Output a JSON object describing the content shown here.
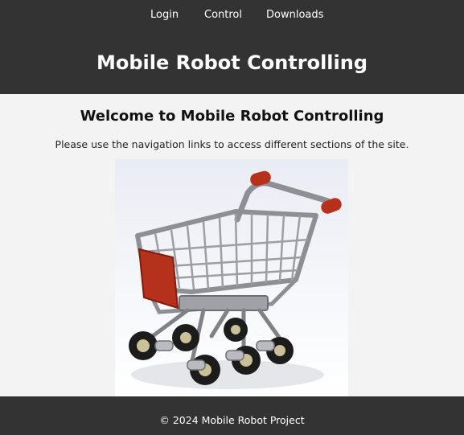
{
  "nav": {
    "items": [
      {
        "label": "Login"
      },
      {
        "label": "Control"
      },
      {
        "label": "Downloads"
      }
    ]
  },
  "header": {
    "title": "Mobile Robot Controlling"
  },
  "main": {
    "heading": "Welcome to Mobile Robot Controlling",
    "intro": "Please use the navigation links to access different sections of the site.",
    "image": {
      "subject": "shopping-cart-robot",
      "accent_color": "#b5311c",
      "frame_color": "#8d8f94"
    }
  },
  "footer": {
    "text": "© 2024 Mobile Robot Project"
  },
  "colors": {
    "header_bg": "#333333",
    "body_bg": "#f3f3f3",
    "footer_bg": "#333333"
  }
}
